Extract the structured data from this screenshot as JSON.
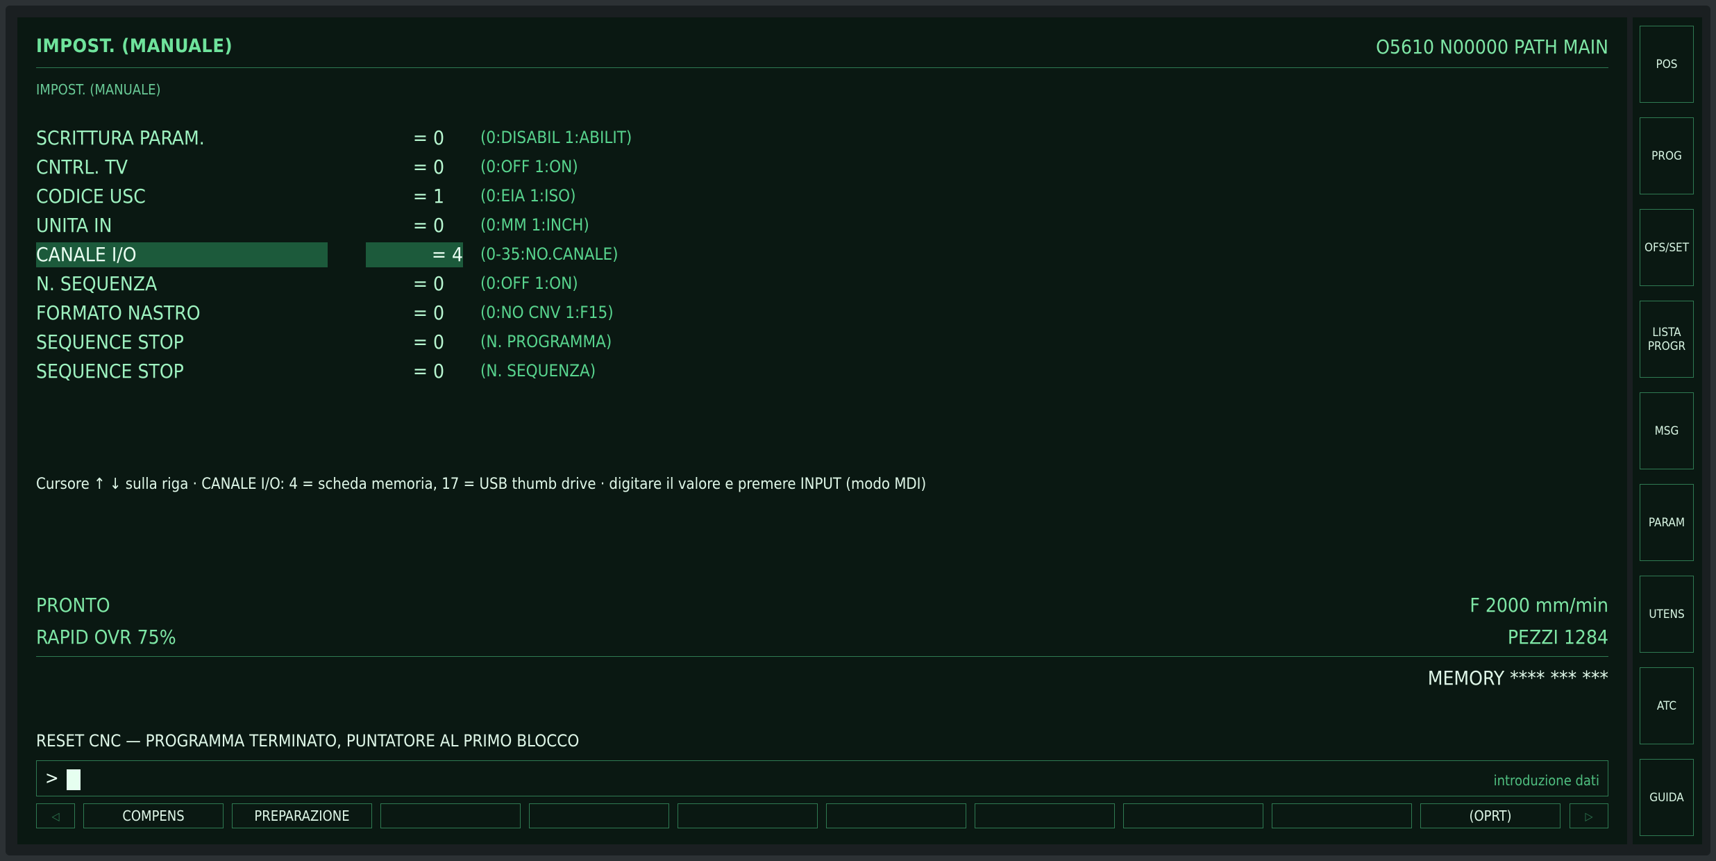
{
  "header": {
    "title": "IMPOST. (MANUALE)",
    "right": "O5610 N00000 PATH MAIN",
    "subtitle": "IMPOST. (MANUALE)"
  },
  "params": [
    {
      "name": "SCRITTURA PARAM.",
      "value": "= 0",
      "hint": "(0:DISABIL 1:ABILIT)"
    },
    {
      "name": "CNTRL. TV",
      "value": "= 0",
      "hint": "(0:OFF 1:ON)"
    },
    {
      "name": "CODICE USC",
      "value": "= 1",
      "hint": "(0:EIA 1:ISO)"
    },
    {
      "name": "UNITA IN",
      "value": "= 0",
      "hint": "(0:MM 1:INCH)"
    },
    {
      "name": "CANALE I/O",
      "value": "= 4",
      "hint": "(0-35:NO.CANALE)",
      "selected": true
    },
    {
      "name": "N. SEQUENZA",
      "value": "= 0",
      "hint": "(0:OFF 1:ON)"
    },
    {
      "name": "FORMATO NASTRO",
      "value": "= 0",
      "hint": "(0:NO CNV 1:F15)"
    },
    {
      "name": "SEQUENCE STOP",
      "value": "= 0",
      "hint": "(N. PROGRAMMA)"
    },
    {
      "name": "SEQUENCE STOP",
      "value": "= 0",
      "hint": "(N. SEQUENZA)"
    }
  ],
  "help_text": "Cursore ↑ ↓ sulla riga · CANALE I/O: 4 = scheda memoria, 17 = USB thumb drive · digitare il valore e premere INPUT (modo MDI)",
  "status": {
    "state": "PRONTO",
    "rapid": "RAPID OVR 75%",
    "feed": "F 2000 mm/min",
    "parts": "PEZZI 1284",
    "memory": "MEMORY **** *** ***"
  },
  "alarm_message": "RESET CNC — PROGRAMMA TERMINATO, PUNTATORE AL PRIMO BLOCCO",
  "input": {
    "prompt": ">",
    "hint": "introduzione dati"
  },
  "softkeys": {
    "left_arrow": "◁",
    "right_arrow": "▷",
    "keys": [
      "COMPENS",
      "PREPARAZIONE",
      "",
      "",
      "",
      "",
      "",
      "",
      "",
      "(OPRT)"
    ]
  },
  "side_keys": [
    "POS",
    "PROG",
    "OFS/SET",
    "LISTA\nPROGR",
    "MSG",
    "PARAM",
    "UTENS",
    "ATC",
    "GUIDA"
  ],
  "colors": {
    "background": "#0a1812",
    "accent": "#7fe3a6",
    "selection": "#1c5a3b",
    "border": "#2f7a52"
  }
}
